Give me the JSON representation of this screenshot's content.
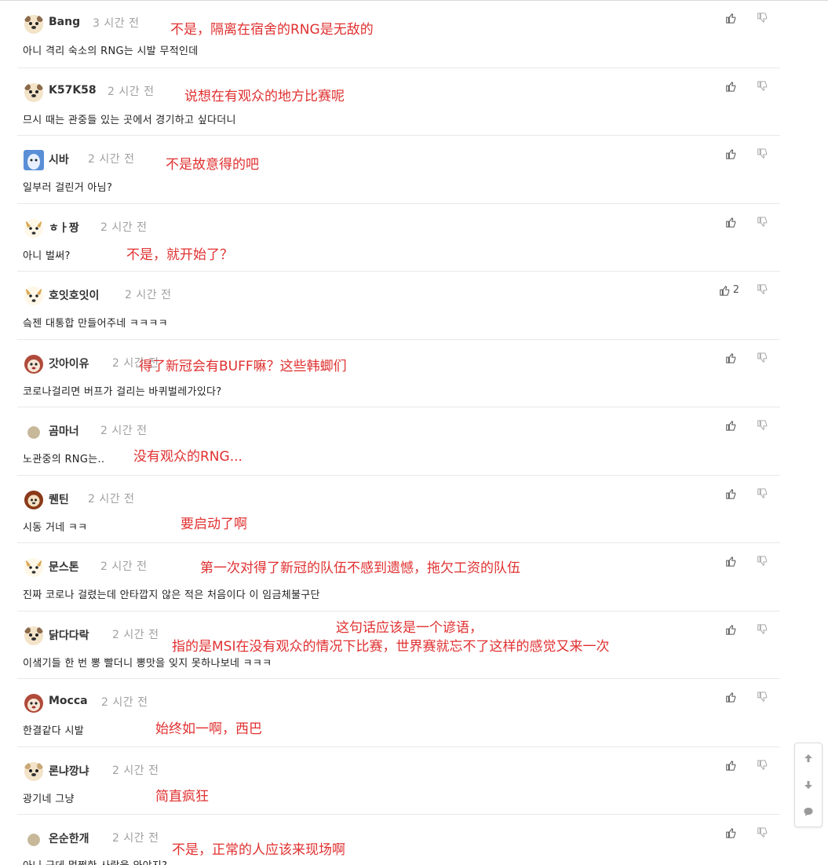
{
  "comments": [
    {
      "user": "Bang",
      "time": "3 시간 전",
      "text": "아니 격리 숙소의 RNG는 시발 무적인데",
      "note": "不是，隔离在宿舍的RNG是无敌的",
      "likes": "",
      "avatar": "bear-face-icon"
    },
    {
      "user": "K57K58",
      "time": "2 시간 전",
      "text": "므시 때는 관중들 있는 곳에서 경기하고 싶다더니",
      "note": "说想在有观众的地方比赛呢",
      "likes": "",
      "avatar": "bear-face-icon"
    },
    {
      "user": "시바",
      "time": "2 시간 전",
      "text": "일부러 걸린거 아님?",
      "note": "不是故意得的吧",
      "likes": "",
      "avatar": "ghost-face-icon"
    },
    {
      "user": "ㅎㅏ짱",
      "time": "2 시간 전",
      "text": "아니 벌써?",
      "note": "不是，就开始了？",
      "likes": "",
      "avatar": "fox-face-icon"
    },
    {
      "user": "호잇호잇이",
      "time": "2 시간 전",
      "text": "슼젠 대통합 만들어주네 ㅋㅋㅋㅋ",
      "note": "",
      "likes": "2",
      "avatar": "fox-face-icon"
    },
    {
      "user": "갓아이유",
      "time": "2 시간 전",
      "text": "코로나걸리면 버프가 걸리는 바퀴벌레가있다?",
      "note": "得了新冠会有BUFF嘛？这些韩蝍们",
      "likes": "",
      "avatar": "monkey-face-icon"
    },
    {
      "user": "곰마너",
      "time": "2 시간 전",
      "text": "노관중의 RNG는..",
      "note": "没有观众的RNG...",
      "likes": "",
      "avatar": "dot-icon"
    },
    {
      "user": "퀜틴",
      "time": "2 시간 전",
      "text": "시동 거네 ㅋㅋ",
      "note": "要启动了啊",
      "likes": "",
      "avatar": "lion-face-icon"
    },
    {
      "user": "문스톤",
      "time": "2 시간 전",
      "text": "진짜 코로나 걸렸는데 안타깝지 않은 적은 처음이다 이 임금체불구단",
      "note": "第一次对得了新冠的队伍不感到遗憾，拖欠工资的队伍",
      "likes": "",
      "avatar": "fox-face-icon"
    },
    {
      "user": "닭다다락",
      "time": "2 시간 전",
      "text": "이샠기들 한 번 뽕 빨더니 뽕맛을 잊지 못하나보네 ㅋㅋㅋ",
      "note": "这句话应该是一个谚语，",
      "note2": "指的是MSI在没有观众的情况下比赛，世界赛就忘不了这样的感觉又来一次",
      "likes": "",
      "avatar": "bear-face-icon"
    },
    {
      "user": "Mocca",
      "time": "2 시간 전",
      "text": "한결같다 시발",
      "note": "始终如一啊，西巴",
      "likes": "",
      "avatar": "monkey-face-icon"
    },
    {
      "user": "론냐깡냐",
      "time": "2 시간 전",
      "text": "광기네 그냥",
      "note": "简直疯狂",
      "likes": "",
      "avatar": "bear-face-icon"
    },
    {
      "user": "온순한개",
      "time": "2 시간 전",
      "text": "아니 근데 멀쩡한 사람을 와야지?",
      "note": "不是，正常的人应该来现场啊",
      "likes": "",
      "avatar": "dot-icon"
    }
  ],
  "toolbar": {
    "up": "arrow-up-icon",
    "down": "arrow-down-icon",
    "comment": "comment-icon"
  },
  "colors": {
    "note": "#e03030",
    "time": "#a0a0a0",
    "divider": "#e8e8e8"
  }
}
